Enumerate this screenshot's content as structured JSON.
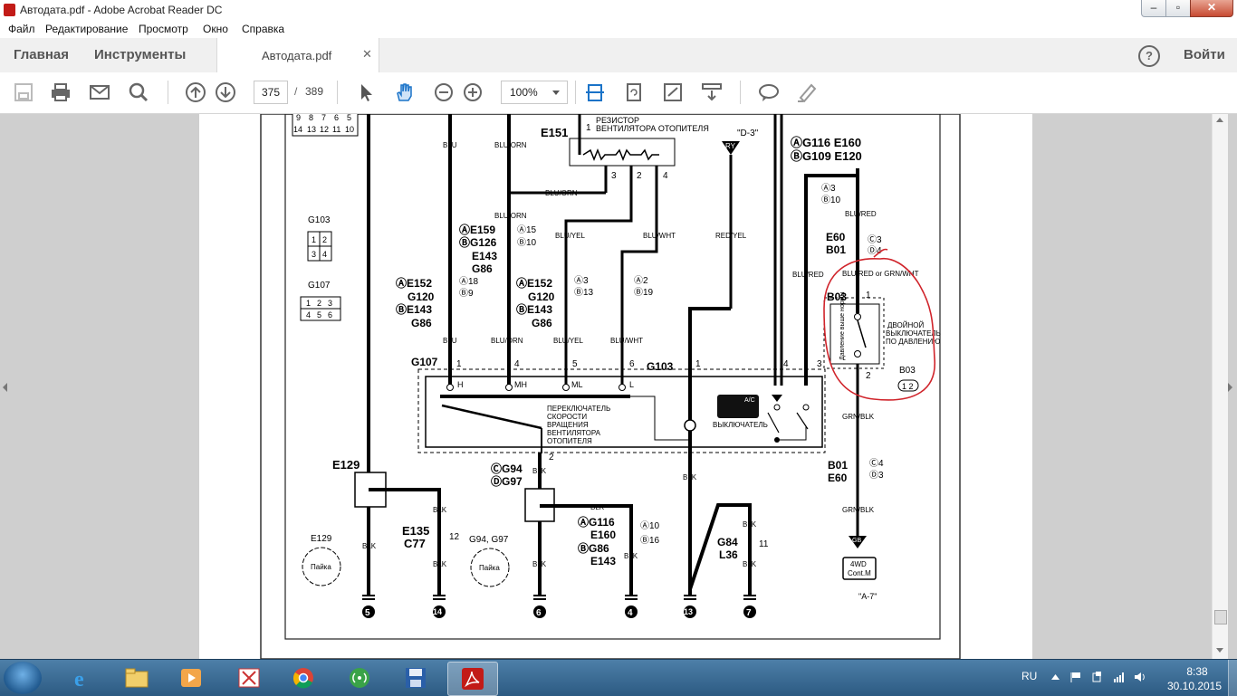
{
  "window": {
    "title": "Автодата.pdf - Adobe Acrobat Reader DC"
  },
  "menu": [
    "Файл",
    "Редактирование",
    "Просмотр",
    "Окно",
    "Справка"
  ],
  "tabs": {
    "home": "Главная",
    "tools": "Инструменты",
    "document": "Автодата.pdf",
    "signin": "Войти"
  },
  "toolbar": {
    "current_page": "375",
    "page_separator": "/",
    "total_pages": "389",
    "zoom": "100%"
  },
  "diagram": {
    "connector_pins_top": [
      "9",
      "8",
      "7",
      "6",
      "5",
      "14",
      "13",
      "12",
      "11",
      "10"
    ],
    "resistor": {
      "id": "E151",
      "label_line1": "РЕЗИСТОР",
      "label_line2": "ВЕНТИЛЯТОРА ОТОПИТЕЛЯ",
      "pins": [
        "1",
        "3",
        "2",
        "4"
      ]
    },
    "top_right_ref": "\"D-3\"",
    "ry": "RY",
    "g116_top": {
      "a": "ⒶG116 E160",
      "b": "ⒷG109 E120"
    },
    "wires": {
      "blu": "BLU",
      "blu_orn": "BLU/ORN",
      "blu_yel": "BLU/YEL",
      "blu_wht": "BLU/WHT",
      "red_yel": "RED/YEL",
      "blu_red": "BLU/RED",
      "blu_red_or": "BLU/RED or GRN/WHT",
      "grn_blk": "GRN/BLK",
      "blk": "BLK"
    },
    "g103_conn": {
      "label": "G103",
      "pins": [
        "1",
        "2",
        "3",
        "4"
      ]
    },
    "g107_conn": {
      "label": "G107",
      "pins": [
        "1",
        "2",
        "3",
        "4",
        "5",
        "6"
      ]
    },
    "connectors_mid": {
      "e159": "ⒶE159",
      "g126": "ⒷG126",
      "e143": "E143",
      "g86": "G86",
      "a15": "Ⓐ15",
      "b10": "Ⓑ10",
      "e152": "ⒶE152",
      "g120": "G120",
      "e143b": "ⒷE143",
      "g86b": "G86",
      "a18": "Ⓐ18",
      "b9": "Ⓑ9",
      "a3": "Ⓐ3",
      "b13": "Ⓑ13",
      "a2": "Ⓐ2",
      "b19": "Ⓑ19",
      "a3r": "Ⓐ3",
      "b10r": "Ⓑ10",
      "e60": "E60",
      "b01": "B01",
      "c3": "Ⓒ3",
      "d4": "Ⓓ4"
    },
    "switch_conn": {
      "g107": "G107",
      "g103": "G103",
      "pin_numbers": [
        "1",
        "4",
        "5",
        "6",
        "1",
        "4",
        "3"
      ],
      "pins": [
        "H",
        "MH",
        "ML",
        "L"
      ]
    },
    "switch_label": [
      "ПЕРЕКЛЮЧАТЕЛЬ",
      "СКОРОСТИ",
      "ВРАЩЕНИЯ",
      "ВЕНТИЛЯТОРА",
      "ОТОПИТЕЛЯ"
    ],
    "switch_button": "ВЫКЛЮЧАТЕЛЬ",
    "ac_label": "A/C",
    "pressure_switch": {
      "id": "B03",
      "pin1": "1",
      "pin2": "2",
      "side_label": "Давление выше нормы",
      "label": [
        "ДВОЙНОЙ",
        "ВЫКЛЮЧАТЕЛЬ",
        "ПО ДАВЛЕНИЮ"
      ],
      "conn_id": "B03",
      "conn_pins": "1 2"
    },
    "bottom_right": {
      "b01": "B01",
      "e60": "E60",
      "c4": "Ⓒ4",
      "d3": "Ⓓ3",
      "gb": "GB",
      "module": [
        "4WD",
        "Cont.M"
      ],
      "ref": "\"A-7\""
    },
    "splices": {
      "e129": "E129",
      "e129_label": "E129",
      "e135": "E135",
      "c77": "C77",
      "pin12": "12",
      "g94": "ⒸG94",
      "g97": "ⒹG97",
      "g94_label": "G94, G97",
      "g116b": "ⒶG116",
      "e160b": "E160",
      "g86c": "ⒷG86",
      "e143c": "E143",
      "a10": "Ⓐ10",
      "b16": "Ⓑ16",
      "g84": "G84",
      "l36": "L36",
      "pin11": "11",
      "splice_text": "Пайка",
      "pin2": "2"
    },
    "grounds": [
      "5",
      "14",
      "6",
      "4",
      "13",
      "7"
    ]
  },
  "taskbar": {
    "lang": "RU",
    "time": "8:38",
    "date": "30.10.2015"
  },
  "colors": {
    "annotation": "#d0242b",
    "acrobat_red": "#c21b17",
    "toolbar_blue": "#1a73c8"
  }
}
